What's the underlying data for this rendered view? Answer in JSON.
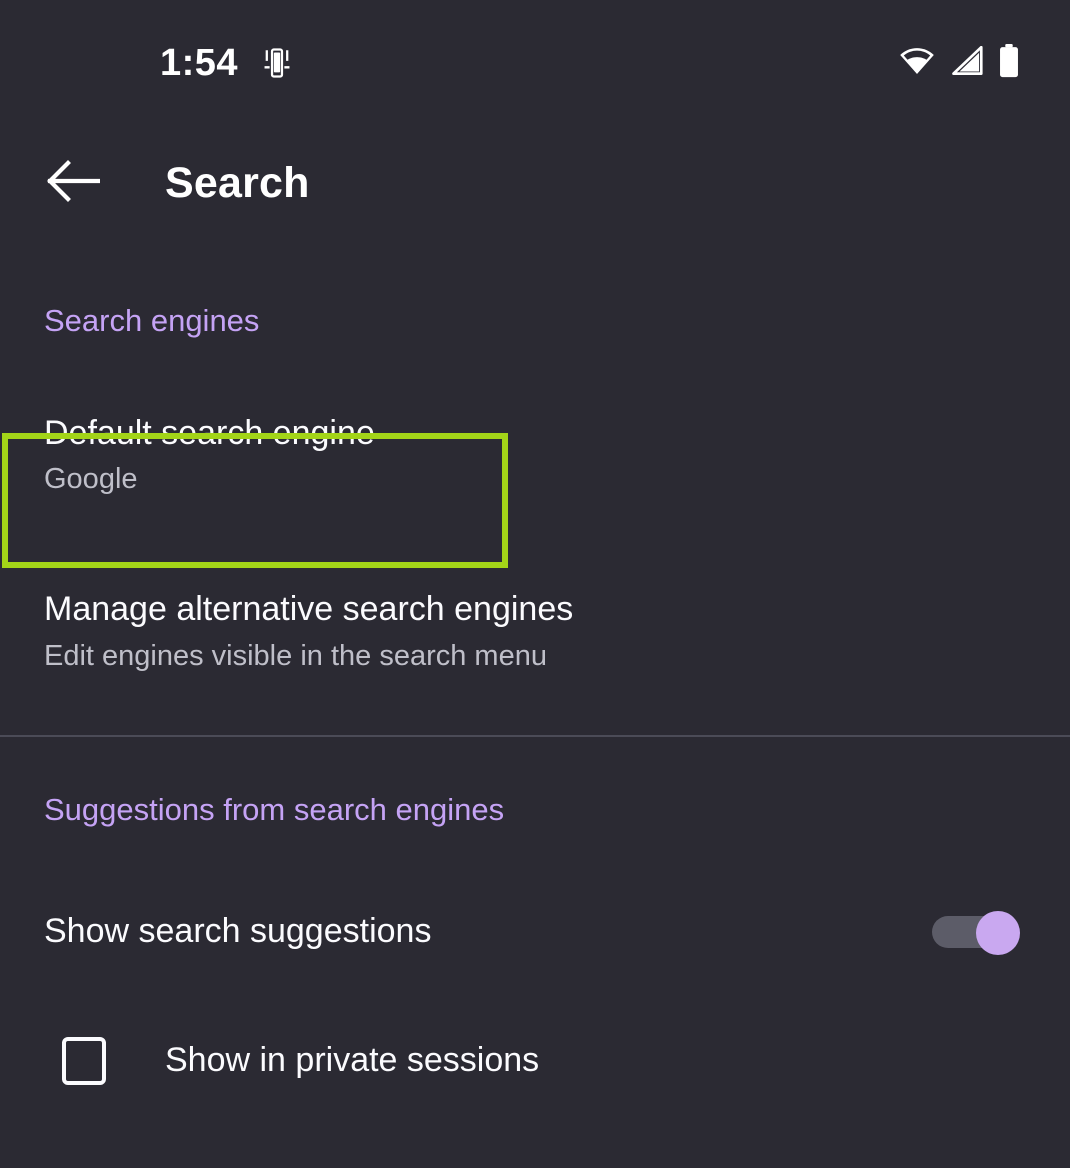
{
  "status_bar": {
    "clock": "1:54",
    "icons": {
      "rotation": "screen-rotation-icon",
      "wifi": "wifi-icon",
      "cellular": "cellular-signal-icon",
      "battery": "battery-icon"
    }
  },
  "appbar": {
    "back_icon": "back-arrow-icon",
    "title": "Search"
  },
  "sections": [
    {
      "header": "Search engines",
      "items": [
        {
          "title": "Default search engine",
          "summary": "Google",
          "highlighted": true
        },
        {
          "title": "Manage alternative search engines",
          "summary": "Edit engines visible in the search menu",
          "highlighted": false
        }
      ]
    },
    {
      "header": "Suggestions from search engines",
      "items": [
        {
          "title": "Show search suggestions",
          "control": "switch",
          "value": "on"
        },
        {
          "title": "Show in private sessions",
          "control": "checkbox",
          "value": "off"
        }
      ]
    }
  ],
  "colors": {
    "background": "#2b2a33",
    "accent_purple": "#c5a3f5",
    "highlight_green": "#a3d418",
    "switch_thumb": "#c9a8f0",
    "switch_track": "#5c5c68",
    "primary_text": "#fbfbfe",
    "secondary_text": "#bfbfc9",
    "divider": "#4b4b57"
  }
}
